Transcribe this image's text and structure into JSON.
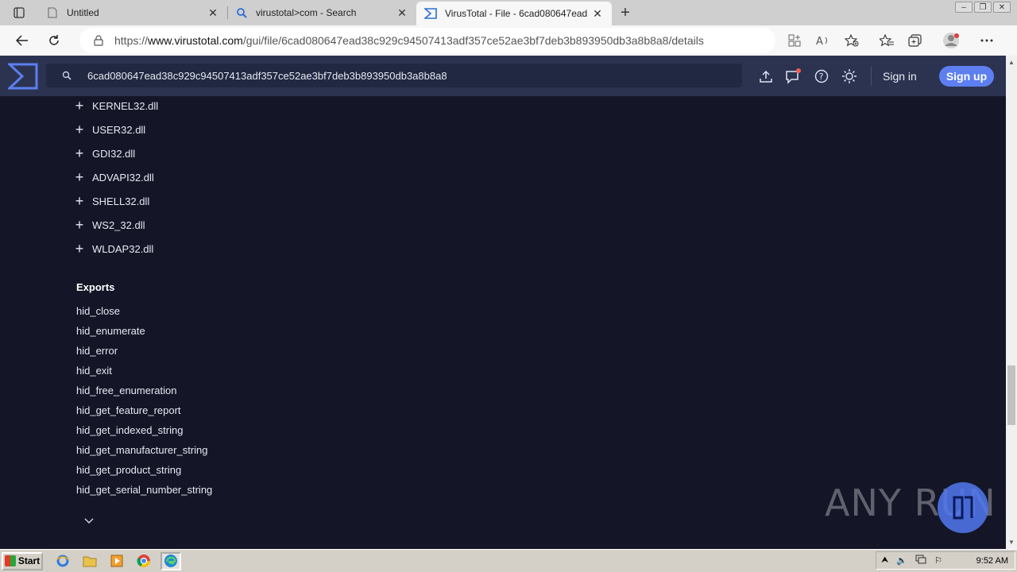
{
  "tabs": [
    {
      "title": "Untitled",
      "favicon": "page-icon",
      "active": false
    },
    {
      "title": "virustotal>com - Search",
      "favicon": "search-icon",
      "active": false
    },
    {
      "title": "VirusTotal - File - 6cad080647ead",
      "favicon": "virustotal-icon",
      "active": true
    }
  ],
  "address": {
    "prefix": "https://",
    "host": "www.virustotal.com",
    "path": "/gui/file/6cad080647ead38c929c94507413adf357ce52ae3bf7deb3b893950db3a8b8a8/details"
  },
  "vt": {
    "search_value": "6cad080647ead38c929c94507413adf357ce52ae3bf7deb3b893950db3a8b8a8",
    "signin": "Sign in",
    "signup": "Sign up",
    "accent": "#5d7ff0",
    "notification_color": "#f25c54"
  },
  "imports": [
    "KERNEL32.dll",
    "USER32.dll",
    "GDI32.dll",
    "ADVAPI32.dll",
    "SHELL32.dll",
    "WS2_32.dll",
    "WLDAP32.dll"
  ],
  "exports": {
    "title": "Exports",
    "items": [
      "hid_close",
      "hid_enumerate",
      "hid_error",
      "hid_exit",
      "hid_free_enumeration",
      "hid_get_feature_report",
      "hid_get_indexed_string",
      "hid_get_manufacturer_string",
      "hid_get_product_string",
      "hid_get_serial_number_string"
    ]
  },
  "watermark": "ANY RUN",
  "taskbar": {
    "start": "Start",
    "clock": "9:52 AM"
  }
}
